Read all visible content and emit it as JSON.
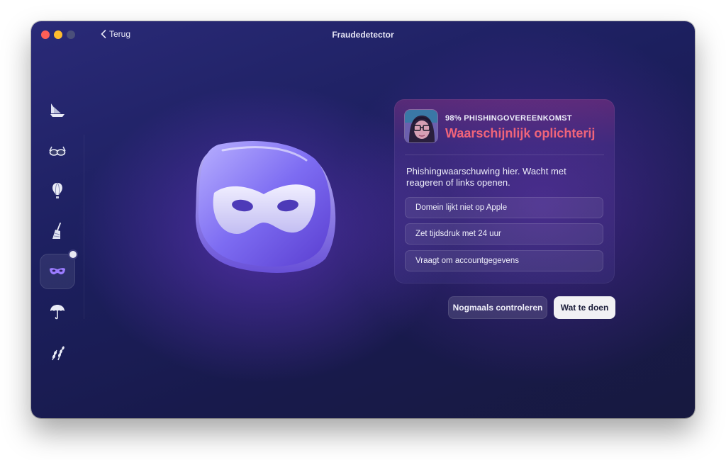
{
  "window": {
    "title": "Fraudedetector"
  },
  "toolbar": {
    "back_label": "Terug"
  },
  "sidebar": {
    "items": [
      {
        "icon": "ship-icon"
      },
      {
        "icon": "glasses-icon"
      },
      {
        "icon": "balloon-icon"
      },
      {
        "icon": "broom-icon"
      },
      {
        "icon": "mask-icon",
        "active": true
      },
      {
        "icon": "umbrella-icon"
      },
      {
        "icon": "wheat-icon"
      }
    ]
  },
  "result": {
    "match_label": "98% PHISHINGOVEREENKOMST",
    "verdict": "Waarschijnlijk oplichterij",
    "description": "Phishingwaarschuwing hier. Wacht met reageren of links openen.",
    "reasons": [
      "Domein lijkt niet op Apple",
      "Zet tijdsdruk met 24 uur",
      "Vraagt om accountgegevens"
    ]
  },
  "actions": {
    "recheck_label": "Nogmaals controleren",
    "what_to_do_label": "Wat te doen"
  },
  "colors": {
    "verdict": "#f0647a",
    "accent_card": "#8a4fc0",
    "primary_button": "#f1f1f4"
  }
}
